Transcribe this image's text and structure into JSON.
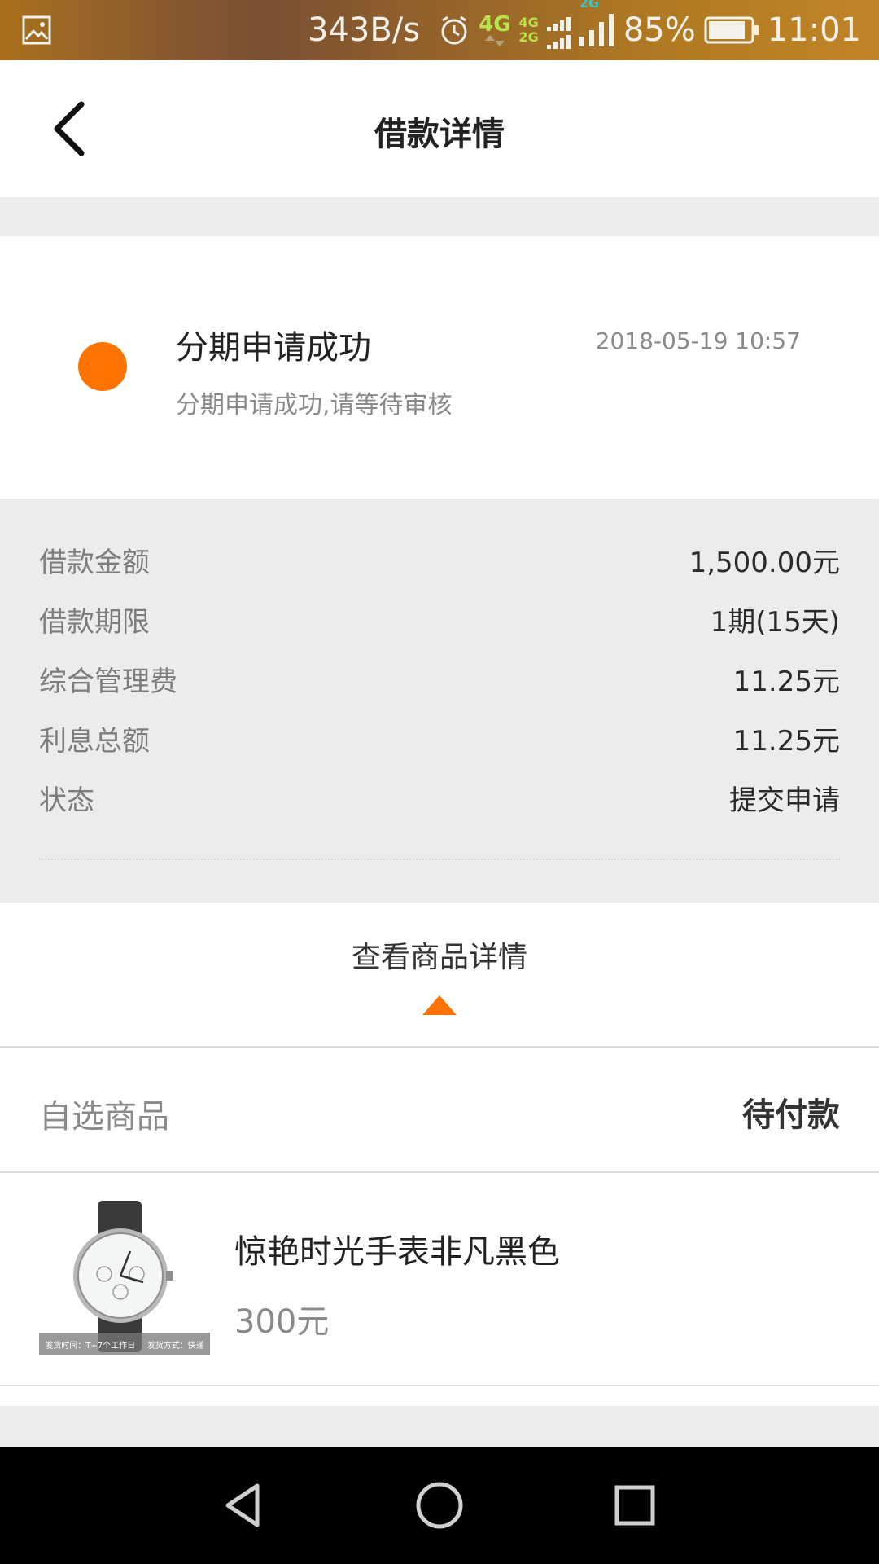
{
  "status_bar": {
    "net_speed": "343B/s",
    "network_4g": "4G",
    "network_4g_small": "4G",
    "network_2g_small": "2G",
    "network_2g": "2G",
    "battery": "85%",
    "time": "11:01",
    "battery_level": 0.85
  },
  "header": {
    "title": "借款详情"
  },
  "status": {
    "title": "分期申请成功",
    "time": "2018-05-19 10:57",
    "description": "分期申请成功,请等待审核",
    "dot_color": "#ff7300"
  },
  "details": [
    {
      "label": "借款金额",
      "value": "1,500.00元"
    },
    {
      "label": "借款期限",
      "value": "1期(15天)"
    },
    {
      "label": "综合管理费",
      "value": "11.25元"
    },
    {
      "label": "利息总额",
      "value": "11.25元"
    },
    {
      "label": "状态",
      "value": "提交申请"
    }
  ],
  "view_goods": {
    "label": "查看商品详情"
  },
  "goods": {
    "category": "自选商品",
    "status": "待付款"
  },
  "product": {
    "name": "惊艳时光手表非凡黑色",
    "price": "300元",
    "thumb_caption_left": "发货时间：T+7个工作日",
    "thumb_caption_right": "发货方式：快递"
  },
  "colors": {
    "accent": "#ff7300",
    "background_band": "#ececec"
  }
}
